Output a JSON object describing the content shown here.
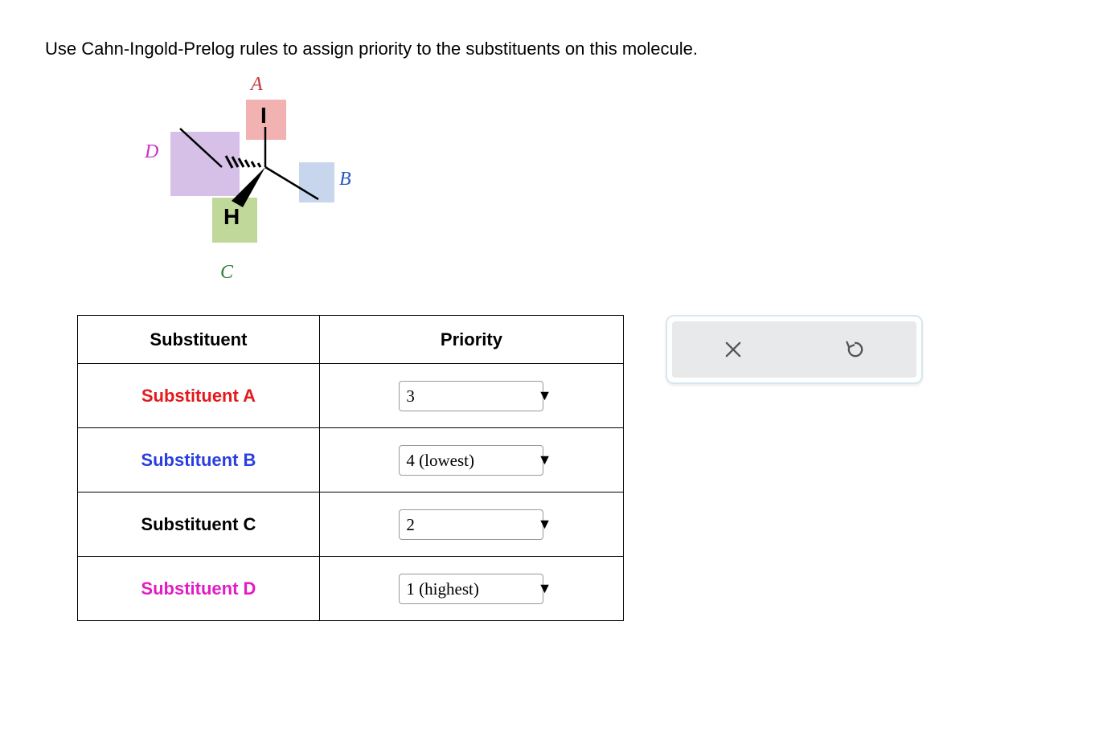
{
  "question": "Use Cahn-Ingold-Prelog rules to assign priority to the substituents on this molecule.",
  "molecule": {
    "labels": {
      "A": "A",
      "B": "B",
      "C": "C",
      "D": "D"
    },
    "atoms": {
      "I": "I",
      "H": "H"
    }
  },
  "table": {
    "headers": {
      "substituent": "Substituent",
      "priority": "Priority"
    },
    "rows": [
      {
        "name": "Substituent A",
        "priority": "3"
      },
      {
        "name": "Substituent B",
        "priority": "4 (lowest)"
      },
      {
        "name": "Substituent C",
        "priority": "2"
      },
      {
        "name": "Substituent D",
        "priority": "1 (highest)"
      }
    ]
  },
  "toolbar": {
    "close_icon": "close-icon",
    "reset_icon": "reset-icon"
  }
}
